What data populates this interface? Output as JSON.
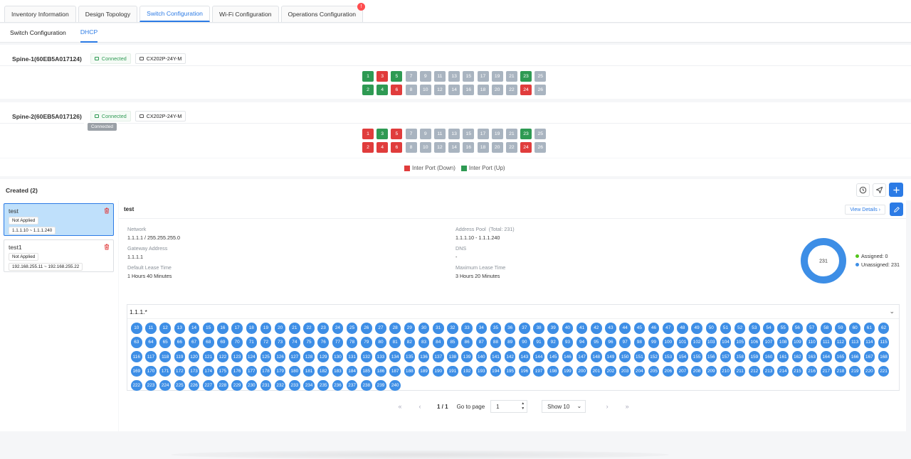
{
  "top_tabs": [
    {
      "label": "Inventory Information",
      "active": false
    },
    {
      "label": "Design Topology",
      "active": false
    },
    {
      "label": "Switch Configuration",
      "active": true
    },
    {
      "label": "Wi-Fi Configuration",
      "active": false
    },
    {
      "label": "Operations Configuration",
      "active": false,
      "badge": "!"
    }
  ],
  "sub_tabs": [
    {
      "label": "Switch Configuration",
      "active": false
    },
    {
      "label": "DHCP",
      "active": true
    }
  ],
  "devices": [
    {
      "name": "Spine-1(60EB5A017124)",
      "status": "Connected",
      "model": "CX202P-24Y-M",
      "top": [
        {
          "n": "1",
          "s": "up"
        },
        {
          "n": "3",
          "s": "down"
        },
        {
          "n": "5",
          "s": "up"
        },
        {
          "n": "7",
          "s": "none"
        },
        {
          "n": "9",
          "s": "none"
        },
        {
          "n": "11",
          "s": "none"
        },
        {
          "n": "13",
          "s": "none"
        },
        {
          "n": "15",
          "s": "none"
        },
        {
          "n": "17",
          "s": "none"
        },
        {
          "n": "19",
          "s": "none"
        },
        {
          "n": "21",
          "s": "none"
        },
        {
          "n": "23",
          "s": "up"
        },
        {
          "n": "25",
          "s": "none"
        }
      ],
      "bottom": [
        {
          "n": "2",
          "s": "up"
        },
        {
          "n": "4",
          "s": "up"
        },
        {
          "n": "6",
          "s": "down"
        },
        {
          "n": "8",
          "s": "none"
        },
        {
          "n": "10",
          "s": "none"
        },
        {
          "n": "12",
          "s": "none"
        },
        {
          "n": "14",
          "s": "none"
        },
        {
          "n": "16",
          "s": "none"
        },
        {
          "n": "18",
          "s": "none"
        },
        {
          "n": "20",
          "s": "none"
        },
        {
          "n": "22",
          "s": "none"
        },
        {
          "n": "24",
          "s": "down"
        },
        {
          "n": "26",
          "s": "none"
        }
      ]
    },
    {
      "name": "Spine-2(60EB5A017126)",
      "status": "Connected",
      "model": "CX202P-24Y-M",
      "tooltip": "Connected",
      "top": [
        {
          "n": "1",
          "s": "down"
        },
        {
          "n": "3",
          "s": "up"
        },
        {
          "n": "5",
          "s": "down"
        },
        {
          "n": "7",
          "s": "none"
        },
        {
          "n": "9",
          "s": "none"
        },
        {
          "n": "11",
          "s": "none"
        },
        {
          "n": "13",
          "s": "none"
        },
        {
          "n": "15",
          "s": "none"
        },
        {
          "n": "17",
          "s": "none"
        },
        {
          "n": "19",
          "s": "none"
        },
        {
          "n": "21",
          "s": "none"
        },
        {
          "n": "23",
          "s": "up"
        },
        {
          "n": "25",
          "s": "none"
        }
      ],
      "bottom": [
        {
          "n": "2",
          "s": "down"
        },
        {
          "n": "4",
          "s": "down"
        },
        {
          "n": "6",
          "s": "down"
        },
        {
          "n": "8",
          "s": "none"
        },
        {
          "n": "10",
          "s": "none"
        },
        {
          "n": "12",
          "s": "none"
        },
        {
          "n": "14",
          "s": "none"
        },
        {
          "n": "16",
          "s": "none"
        },
        {
          "n": "18",
          "s": "none"
        },
        {
          "n": "20",
          "s": "none"
        },
        {
          "n": "22",
          "s": "none"
        },
        {
          "n": "24",
          "s": "down"
        },
        {
          "n": "26",
          "s": "none"
        }
      ]
    }
  ],
  "legend": {
    "down": "Inter Port (Down)",
    "up": "Inter Port (Up)"
  },
  "colors": {
    "up": "#2e9a53",
    "down": "#e03c3c",
    "none": "#a9b4c0",
    "accent": "#2c7be5",
    "assigned": "#52c41a",
    "unassigned": "#3d8ee6"
  },
  "created": {
    "title": "Created (2)",
    "items": [
      {
        "name": "test",
        "status": "Not Applied",
        "range": "1.1.1.10 ~ 1.1.1.240",
        "selected": true
      },
      {
        "name": "test1",
        "status": "Not Applied",
        "range": "192.168.255.11 ~ 192.168.255.22",
        "selected": false
      }
    ]
  },
  "detail": {
    "title": "test",
    "view_details": "View Details",
    "network_label": "Network",
    "network": "1.1.1.1 / 255.255.255.0",
    "gateway_label": "Gateway Address",
    "gateway": "1.1.1.1",
    "lease_label": "Default Lease Time",
    "lease": "1 Hours 40 Minutes",
    "pool_label": "Address Pool",
    "pool_total": "(Total: 231)",
    "pool": "1.1.1.10 - 1.1.1.240",
    "dns_label": "DNS",
    "dns": "-",
    "max_lease_label": "Maximum Lease Time",
    "max_lease": "3 Hours 20 Minutes",
    "donut_center": "231",
    "assigned": "Assigned: 0",
    "unassigned": "Unassigned: 231",
    "assigned_count": 0,
    "unassigned_count": 231
  },
  "ip_section": {
    "prefix": "1.1.1.*",
    "first": 10,
    "last": 240
  },
  "pager": {
    "page": "1 / 1",
    "goto_label": "Go to page",
    "goto_value": "1",
    "show": "Show 10"
  }
}
